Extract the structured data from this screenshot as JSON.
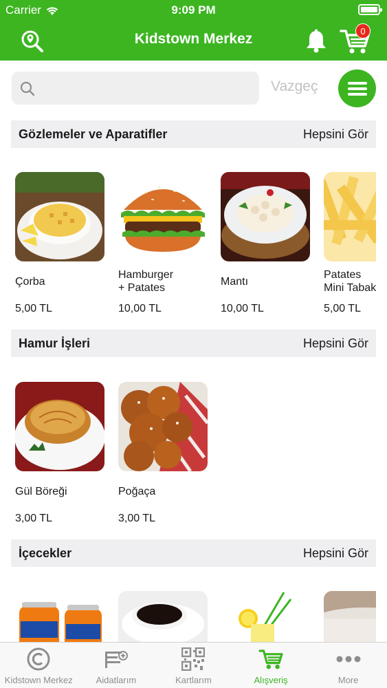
{
  "status_bar": {
    "carrier": "Carrier",
    "time": "9:09 PM"
  },
  "header": {
    "title": "Kidstown Merkez",
    "cart_count": "0",
    "left_icon": "location-search-icon",
    "bell_icon": "bell-icon",
    "cart_icon": "cart-icon"
  },
  "search": {
    "placeholder": "",
    "value": "",
    "cancel_label": "Vazgeç",
    "menu_icon": "hamburger-menu-icon"
  },
  "colors": {
    "brand_green": "#3cb521",
    "badge_red": "#e8281c",
    "section_bg": "#efeff1"
  },
  "sections": [
    {
      "title": "Gözlemeler ve Aparatifler",
      "see_all": "Hepsini Gör",
      "items": [
        {
          "name": "Çorba",
          "price": "5,00 TL",
          "image": "soup-photo"
        },
        {
          "name": "Hamburger\n+ Patates",
          "price": "10,00 TL",
          "image": "burger-photo"
        },
        {
          "name": "Mantı",
          "price": "10,00 TL",
          "image": "manti-photo"
        },
        {
          "name": "Patates\nMini Tabak",
          "price": "5,00 TL",
          "image": "fries-photo"
        }
      ]
    },
    {
      "title": "Hamur İşleri",
      "see_all": "Hepsini Gör",
      "items": [
        {
          "name": "Gül Böreği",
          "price": "3,00 TL",
          "image": "borek-photo"
        },
        {
          "name": "Poğaça",
          "price": "3,00 TL",
          "image": "pogaca-photo"
        }
      ]
    },
    {
      "title": "İçecekler",
      "see_all": "Hepsini Gör",
      "items": [
        {
          "image": "fanta-photo"
        },
        {
          "image": "coffee-photo"
        },
        {
          "image": "lemonade-photo"
        },
        {
          "image": "cup-photo"
        }
      ]
    }
  ],
  "tabs": [
    {
      "label": "Kidstown Merkez",
      "icon": "copyright-icon",
      "active": false
    },
    {
      "label": "Aidatlarım",
      "icon": "fees-icon",
      "active": false
    },
    {
      "label": "Kartlarım",
      "icon": "qr-code-icon",
      "active": false
    },
    {
      "label": "Alışveriş",
      "icon": "shopping-cart-icon",
      "active": true
    },
    {
      "label": "More",
      "icon": "more-dots-icon",
      "active": false
    }
  ]
}
